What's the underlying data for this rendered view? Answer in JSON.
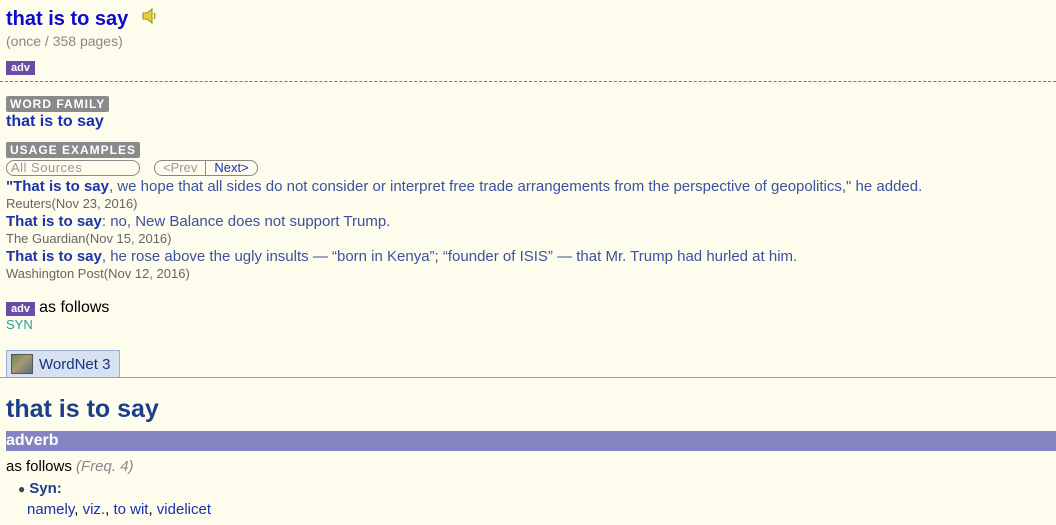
{
  "entry": {
    "headword": "that is to say",
    "frequency": "(once / 358 pages)",
    "pos": "adv"
  },
  "word_family": {
    "label": "WORD FAMILY",
    "word": "that is to say"
  },
  "usage_examples": {
    "label": "USAGE EXAMPLES",
    "source_select": "All Sources",
    "prev": "<Prev",
    "next": "Next>",
    "items": [
      {
        "phrase": "\"That is to say",
        "rest": ", we hope that all sides do not consider or interpret free trade arrangements from the perspective of geopolitics,\" he added.",
        "source": "Reuters(Nov 23, 2016)"
      },
      {
        "phrase": "That is to say",
        "rest": ": no, New Balance does not support Trump.",
        "source": "The Guardian(Nov 15, 2016)"
      },
      {
        "phrase": "That is to say",
        "rest": ", he rose above the ugly insults — “born in Kenya”; “founder of ISIS” — that Mr. Trump had hurled at him.",
        "source": "Washington Post(Nov 12, 2016)"
      }
    ]
  },
  "sense": {
    "pos": "adv",
    "definition": "as follows",
    "syn_link": "SYN"
  },
  "tab": {
    "label": "WordNet 3",
    "icon": "wordnet-icon"
  },
  "wordnet": {
    "headword": "that is to say",
    "pos_bar": "adverb",
    "sense": "as follows",
    "freq": "(Freq. 4)",
    "syn_label": "Syn:",
    "synonyms": [
      "namely",
      "viz.",
      "to wit",
      "videlicet"
    ]
  },
  "colors": {
    "background": "#fefcec",
    "pos_tag": "#6b4aa8",
    "adverb_bar": "#8484c0"
  }
}
